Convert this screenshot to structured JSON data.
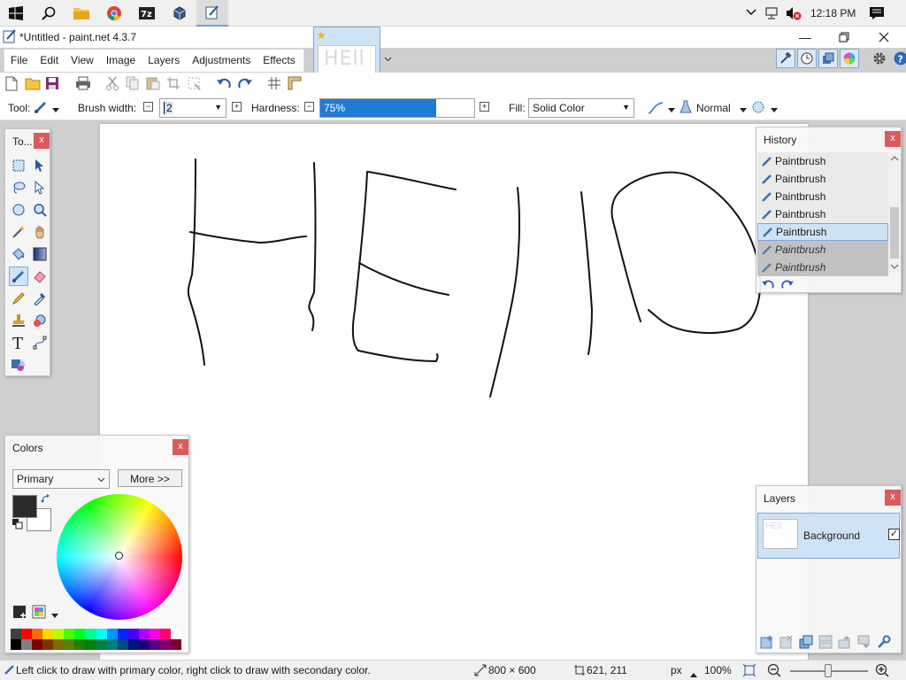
{
  "window": {
    "title": "*Untitled - paint.net 4.3.7"
  },
  "taskbar": {
    "clock": "12:18 PM"
  },
  "menu": {
    "items": [
      "File",
      "Edit",
      "View",
      "Image",
      "Layers",
      "Adjustments",
      "Effects"
    ]
  },
  "thumbnail": {
    "text": "HEll"
  },
  "toolbar": {
    "tool_label": "Tool:",
    "brush_width_label": "Brush width:",
    "brush_width_value": "2",
    "hardness_label": "Hardness:",
    "hardness_value": "75%",
    "hardness_fraction": 0.75,
    "fill_label": "Fill:",
    "fill_value": "Solid Color",
    "blend_mode": "Normal"
  },
  "tools_panel": {
    "title": "To...",
    "close": "x"
  },
  "history_panel": {
    "title": "History",
    "close": "x",
    "items": [
      {
        "label": "Paintbrush",
        "state": "normal"
      },
      {
        "label": "Paintbrush",
        "state": "normal"
      },
      {
        "label": "Paintbrush",
        "state": "normal"
      },
      {
        "label": "Paintbrush",
        "state": "normal"
      },
      {
        "label": "Paintbrush",
        "state": "selected"
      },
      {
        "label": "Paintbrush",
        "state": "undone"
      },
      {
        "label": "Paintbrush",
        "state": "undone"
      }
    ]
  },
  "colors_panel": {
    "title": "Colors",
    "close": "x",
    "mode": "Primary",
    "more_button": "More >>",
    "primary_color": "#2b2b2b",
    "secondary_color": "#ffffff",
    "palette_top": [
      "#404040",
      "#ff0000",
      "#ff6a00",
      "#ffd800",
      "#b6ff00",
      "#4cff00",
      "#00ff21",
      "#00ff90",
      "#00ffff",
      "#0094ff",
      "#0026ff",
      "#4800ff",
      "#b200ff",
      "#ff00dc",
      "#ff006e",
      "#ffffff"
    ],
    "palette_bottom": [
      "#000000",
      "#808080",
      "#7f0000",
      "#7f3300",
      "#7f6a00",
      "#5b7f00",
      "#267f00",
      "#007f0e",
      "#007f46",
      "#007f7f",
      "#004a7f",
      "#00137f",
      "#21007f",
      "#57007f",
      "#7f006e",
      "#7f0037"
    ]
  },
  "layers_panel": {
    "title": "Layers",
    "close": "x",
    "layer_name": "Background",
    "layer_visible_mark": "✓"
  },
  "statusbar": {
    "hint": "Left click to draw with primary color, right click to draw with secondary color.",
    "image_size": "800 × 600",
    "cursor_pos": "621, 211",
    "units": "px",
    "zoom": "100%"
  }
}
